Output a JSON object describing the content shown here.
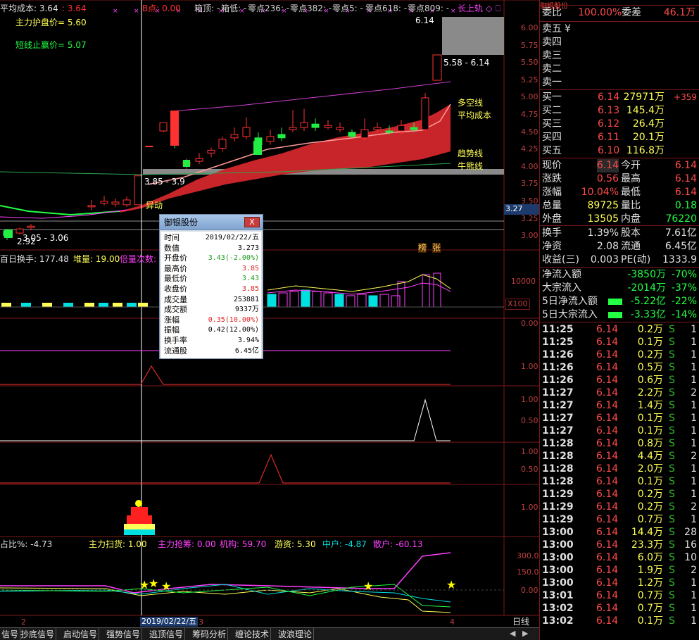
{
  "top_bar": {
    "avg_cost_label": "平均成本: 3.64",
    "avg_cost_val": ": 3.64",
    "b_point": "B点: 0.00",
    "box_top": "箱顶: -",
    "box_low": "箱低: -",
    "zero236": "零点236: -",
    "zero382": "零点382: -",
    "zero5": "零点5: -",
    "zero618": "零点618: -",
    "zero809": "零点809: -",
    "long_up": "长上轨"
  },
  "indicators": {
    "support_price": "主力护盘价= 5.60",
    "stop_price": "短线止赢价= 5.07"
  },
  "price_axis": [
    "6.00",
    "5.75",
    "5.50",
    "5.25",
    "5.00",
    "4.75",
    "4.50",
    "4.25",
    "4.00",
    "3.75",
    "3.50",
    "3.25",
    "3.00"
  ],
  "current_price_tag": "3.27",
  "chart_labels": {
    "high": "6.14",
    "range_top": "5.58 - 6.14",
    "range_left": "3.85 - 3.9",
    "range_low": "3.05 - 3.06",
    "low": "2.92",
    "anomaly": "异动",
    "multi_line": "多空线",
    "avg_line": "平均成本",
    "trend_line": "趋势线",
    "bull_line": "牛熊线",
    "badge1": "榜",
    "badge2": "张"
  },
  "vol_panel": {
    "turnover": "百日换手: 177.48",
    "stack": "堆量: 19.00",
    "ratio": "倍量次数:",
    "axis": "10000",
    "x100": "X100"
  },
  "sub_axes": {
    "p3": "0.00",
    "p4": "1.00",
    "p5a": "1.00",
    "p5b": "0.50",
    "p6a": "1.00",
    "p6b": "0.50",
    "p7": "1.00"
  },
  "flow_panel": {
    "ratio": "占比%: -4.73",
    "sweep": "主力扫货: 1.00",
    "grab": "主力抢筹: 0.00",
    "inst": "机构: 59.70",
    "retail_hot": "游资: 5.30",
    "mid": "中户: -4.87",
    "small": "散户: -60.13",
    "axis_a": "300.0",
    "axis_b": "150.0",
    "axis_c": "0.00"
  },
  "date_axis": {
    "label_2": "2",
    "date": "2019/02/22/五",
    "label_3": "3",
    "label_4": "4"
  },
  "bottom_tabs": [
    "信号",
    "抄底信号",
    "启动信号",
    "强势信号",
    "逃顶信号",
    "筹码分析",
    "缠论技术",
    "波浪理论"
  ],
  "bottom_right": "日线",
  "popup": {
    "title": "御银股份",
    "close": "X",
    "rows": [
      {
        "label": "时间",
        "value": "2019/02/22/五",
        "color": "#000000"
      },
      {
        "label": "数值",
        "value": "3.273",
        "color": "#000000"
      },
      {
        "label": "开盘价",
        "value": "3.43(-2.00%)",
        "color": "#1a9a1a"
      },
      {
        "label": "最高价",
        "value": "3.85",
        "color": "#e02020"
      },
      {
        "label": "最低价",
        "value": "3.43",
        "color": "#1a9a1a"
      },
      {
        "label": "收盘价",
        "value": "3.85",
        "color": "#e02020"
      },
      {
        "label": "成交量",
        "value": "253881",
        "color": "#000000"
      },
      {
        "label": "成交额",
        "value": "9337万",
        "color": "#000000"
      },
      {
        "label": "涨幅",
        "value": "0.35(10.00%)",
        "color": "#e02020"
      },
      {
        "label": "振幅",
        "value": "0.42(12.00%)",
        "color": "#000000"
      },
      {
        "label": "换手率",
        "value": "3.94%",
        "color": "#000000"
      },
      {
        "label": "流通股",
        "value": "6.45亿",
        "color": "#000000"
      }
    ]
  },
  "quote": {
    "header_title": "御银股份",
    "wb_label": "委比",
    "wb_val": "100.00%",
    "wc_label": "委差",
    "wc_val": "46.1万",
    "sells": [
      {
        "label": "卖五",
        "price": "",
        "vol": ""
      },
      {
        "label": "卖四",
        "price": "",
        "vol": ""
      },
      {
        "label": "卖三",
        "price": "",
        "vol": ""
      },
      {
        "label": "卖二",
        "price": "",
        "vol": ""
      },
      {
        "label": "卖一",
        "price": "",
        "vol": ""
      }
    ],
    "buys": [
      {
        "label": "买一",
        "price": "6.14",
        "vol": "27971万",
        "chg": "+359"
      },
      {
        "label": "买二",
        "price": "6.13",
        "vol": "145.4万",
        "chg": ""
      },
      {
        "label": "买三",
        "price": "6.12",
        "vol": "26.4万",
        "chg": ""
      },
      {
        "label": "买四",
        "price": "6.11",
        "vol": "20.1万",
        "chg": ""
      },
      {
        "label": "买五",
        "price": "6.10",
        "vol": "116.8万",
        "chg": ""
      }
    ],
    "stats": [
      {
        "l1": "现价",
        "v1": "6.14",
        "l2": "今开",
        "v2": "6.14"
      },
      {
        "l1": "涨跌",
        "v1": "0.56",
        "l2": "最高",
        "v2": "6.14"
      },
      {
        "l1": "涨幅",
        "v1": "10.04%",
        "l2": "最低",
        "v2": "6.14"
      },
      {
        "l1": "总量",
        "v1": "89725",
        "l2": "量比",
        "v2": "0.18"
      },
      {
        "l1": "外盘",
        "v1": "13505",
        "l2": "内盘",
        "v2": "76220"
      }
    ],
    "fund": [
      {
        "l1": "换手",
        "v1": "1.39%",
        "l2": "股本",
        "v2": "7.61亿"
      },
      {
        "l1": "净资",
        "v1": "2.08",
        "l2": "流通",
        "v2": "6.45亿"
      },
      {
        "l1": "收益(三)",
        "v1": "0.003",
        "l2": "PE(动)",
        "v2": "1333.9"
      }
    ],
    "flows": [
      {
        "label": "净流入额",
        "val": "-3850万",
        "pct": "-70%"
      },
      {
        "label": "大宗流入",
        "val": "-2014万",
        "pct": "-37%"
      },
      {
        "label": "5日净流入额",
        "val": "-5.22亿",
        "pct": "-22%"
      },
      {
        "label": "5日大宗流入",
        "val": "-3.33亿",
        "pct": "-14%"
      }
    ],
    "ticks": [
      {
        "t": "11:25",
        "p": "6.14",
        "v": "0.2万",
        "s": "S",
        "n": "1"
      },
      {
        "t": "11:25",
        "p": "6.14",
        "v": "0.1万",
        "s": "S",
        "n": "1"
      },
      {
        "t": "11:26",
        "p": "6.14",
        "v": "0.2万",
        "s": "S",
        "n": "1"
      },
      {
        "t": "11:26",
        "p": "6.14",
        "v": "0.5万",
        "s": "S",
        "n": "1"
      },
      {
        "t": "11:26",
        "p": "6.14",
        "v": "0.6万",
        "s": "S",
        "n": "1"
      },
      {
        "t": "11:27",
        "p": "6.14",
        "v": "2.2万",
        "s": "S",
        "n": "2"
      },
      {
        "t": "11:27",
        "p": "6.14",
        "v": "1.4万",
        "s": "S",
        "n": "1"
      },
      {
        "t": "11:27",
        "p": "6.14",
        "v": "0.1万",
        "s": "S",
        "n": "1"
      },
      {
        "t": "11:27",
        "p": "6.14",
        "v": "0.1万",
        "s": "S",
        "n": "1"
      },
      {
        "t": "11:28",
        "p": "6.14",
        "v": "0.8万",
        "s": "S",
        "n": "1"
      },
      {
        "t": "11:28",
        "p": "6.14",
        "v": "4.4万",
        "s": "S",
        "n": "2"
      },
      {
        "t": "11:28",
        "p": "6.14",
        "v": "2.0万",
        "s": "S",
        "n": "1"
      },
      {
        "t": "11:28",
        "p": "6.14",
        "v": "0.1万",
        "s": "S",
        "n": "1"
      },
      {
        "t": "11:29",
        "p": "6.14",
        "v": "0.2万",
        "s": "S",
        "n": "1"
      },
      {
        "t": "11:29",
        "p": "6.14",
        "v": "0.2万",
        "s": "S",
        "n": "2"
      },
      {
        "t": "11:29",
        "p": "6.14",
        "v": "0.7万",
        "s": "S",
        "n": "1"
      },
      {
        "t": "13:00",
        "p": "6.14",
        "v": "14.4万",
        "s": "S",
        "n": "28"
      },
      {
        "t": "13:00",
        "p": "6.14",
        "v": "23.3万",
        "s": "S",
        "n": "16"
      },
      {
        "t": "13:00",
        "p": "6.14",
        "v": "6.0万",
        "s": "S",
        "n": "10"
      },
      {
        "t": "13:00",
        "p": "6.14",
        "v": "1.9万",
        "s": "S",
        "n": "2"
      },
      {
        "t": "13:00",
        "p": "6.14",
        "v": "1.2万",
        "s": "S",
        "n": "1"
      },
      {
        "t": "13:01",
        "p": "6.14",
        "v": "0.7万",
        "s": "S",
        "n": "1"
      },
      {
        "t": "13:02",
        "p": "6.14",
        "v": "0.7万",
        "s": "S",
        "n": "1"
      },
      {
        "t": "13:02",
        "p": "6.14",
        "v": "0.1万",
        "s": "S",
        "n": "1"
      }
    ]
  },
  "colors": {
    "up": "#ff3232",
    "down": "#00e0e0",
    "bg": "#000000",
    "border": "#7b1818",
    "yellow": "#ffff00",
    "magenta": "#ff40ff"
  }
}
